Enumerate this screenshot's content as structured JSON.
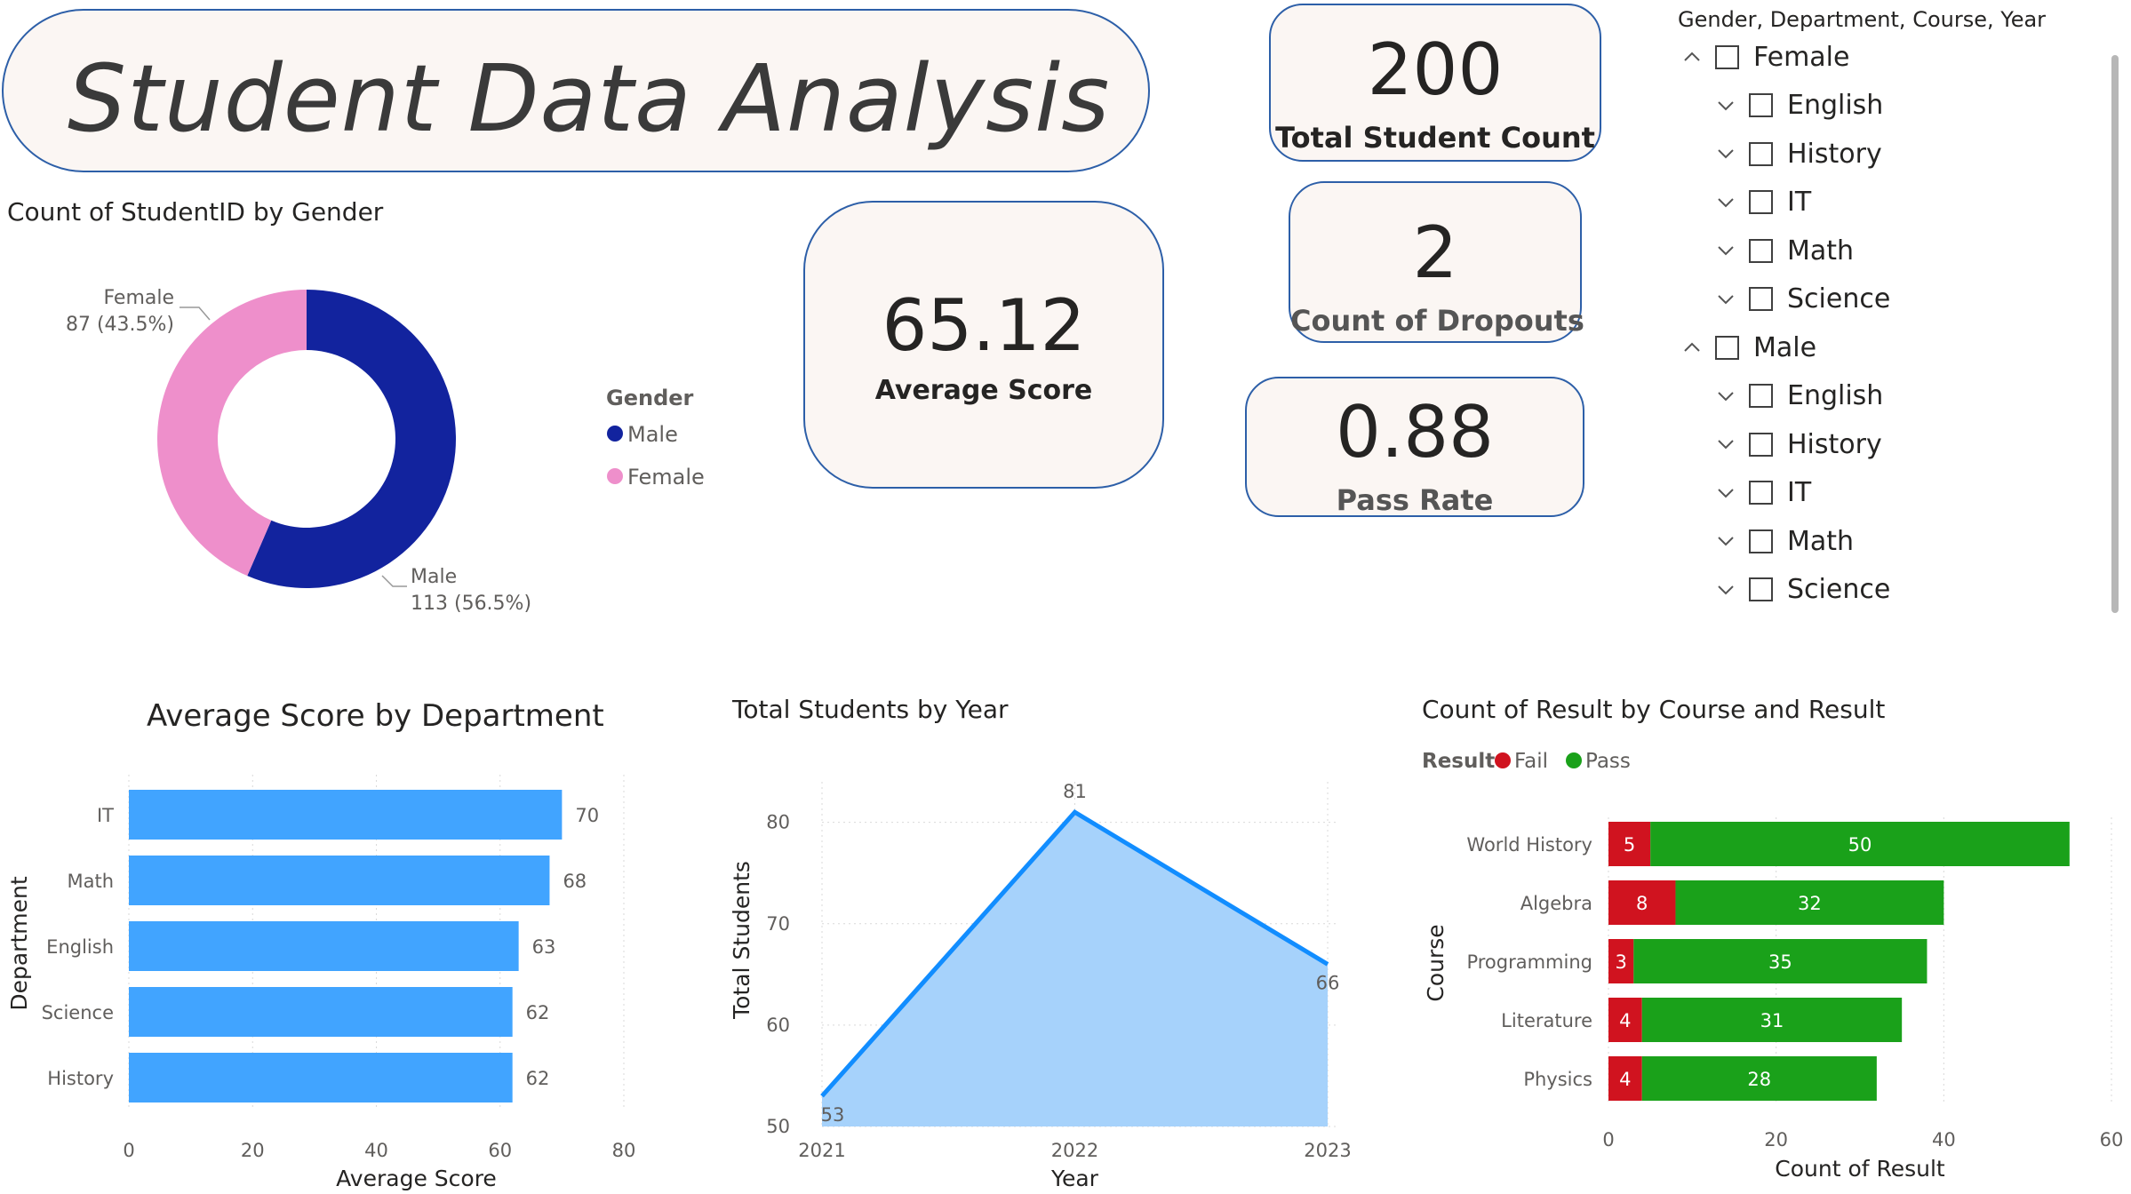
{
  "title": "Student Data Analysis",
  "kpis": {
    "total_students": {
      "value": "200",
      "label": "Total Student Count"
    },
    "dropouts": {
      "value": "2",
      "label": "Count of Dropouts"
    },
    "pass_rate": {
      "value": "0.88",
      "label": "Pass Rate"
    },
    "average_score": {
      "value": "65.12",
      "label": "Average Score"
    }
  },
  "slicer": {
    "title": "Gender, Department, Course, Year",
    "groups": [
      {
        "label": "Female",
        "items": [
          "English",
          "History",
          "IT",
          "Math",
          "Science"
        ]
      },
      {
        "label": "Male",
        "items": [
          "English",
          "History",
          "IT",
          "Math",
          "Science"
        ]
      }
    ]
  },
  "donut": {
    "title": "Count of StudentID by Gender",
    "legend_title": "Gender",
    "colors": {
      "Male": "#12239e",
      "Female": "#ee8fcb"
    },
    "labels": {
      "female_name": "Female",
      "female_value": "87 (43.5%)",
      "male_name": "Male",
      "male_value": "113 (56.5%)"
    },
    "legend": [
      "Male",
      "Female"
    ]
  },
  "chart_data": [
    {
      "type": "pie",
      "title": "Count of StudentID by Gender",
      "categories": [
        "Male",
        "Female"
      ],
      "values": [
        113,
        87
      ],
      "percentages": [
        56.5,
        43.5
      ],
      "legend_title": "Gender",
      "legend": "right"
    },
    {
      "type": "bar",
      "orientation": "horizontal",
      "title": "Average Score by Department",
      "categories": [
        "IT",
        "Math",
        "English",
        "Science",
        "History"
      ],
      "values": [
        70,
        68,
        63,
        62,
        62
      ],
      "xlabel": "Average Score",
      "ylabel": "Department",
      "xlim": [
        0,
        80
      ],
      "xticks": [
        0,
        20,
        40,
        60,
        80
      ],
      "color": "#41a4ff",
      "grid": true
    },
    {
      "type": "area",
      "title": "Total Students by Year",
      "x": [
        "2021",
        "2022",
        "2023"
      ],
      "values": [
        53,
        81,
        66
      ],
      "xlabel": "Year",
      "ylabel": "Total Students",
      "ylim": [
        50,
        84
      ],
      "yticks": [
        50,
        60,
        70,
        80
      ],
      "line_color": "#118dff",
      "fill_color": "#a6d2fb",
      "grid": true
    },
    {
      "type": "bar",
      "orientation": "horizontal",
      "stacked": true,
      "title": "Count of Result by Course and Result",
      "categories": [
        "World History",
        "Algebra",
        "Programming",
        "Literature",
        "Physics"
      ],
      "series": [
        {
          "name": "Fail",
          "values": [
            5,
            8,
            3,
            4,
            4
          ],
          "color": "#d0131f"
        },
        {
          "name": "Pass",
          "values": [
            50,
            32,
            35,
            31,
            28
          ],
          "color": "#1aa11a"
        }
      ],
      "legend_title": "Result",
      "legend": "top-left",
      "xlabel": "Count of Result",
      "ylabel": "Course",
      "xlim": [
        0,
        60
      ],
      "xticks": [
        0,
        20,
        40,
        60
      ],
      "grid": true
    }
  ]
}
